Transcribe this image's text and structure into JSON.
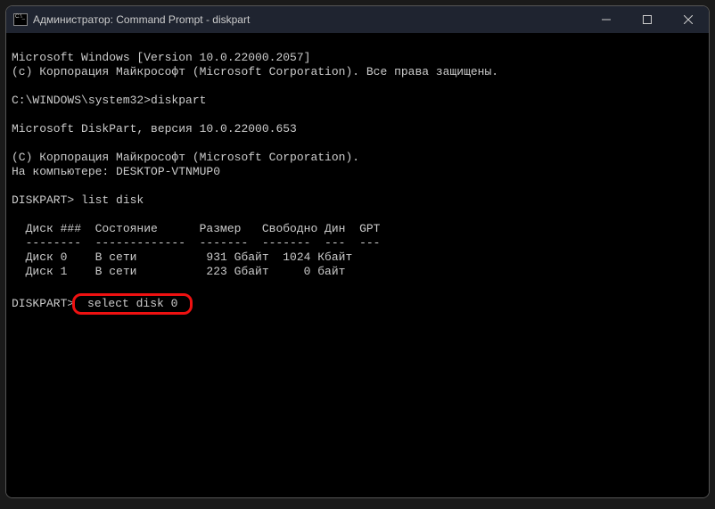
{
  "titlebar": {
    "title": "Администратор: Command Prompt - diskpart"
  },
  "terminal": {
    "line1": "Microsoft Windows [Version 10.0.22000.2057]",
    "line2": "(c) Корпорация Майкрософт (Microsoft Corporation). Все права защищены.",
    "prompt1_path": "C:\\WINDOWS\\system32>",
    "prompt1_cmd": "diskpart",
    "dp_version": "Microsoft DiskPart, версия 10.0.22000.653",
    "dp_copyright": "(C) Корпорация Майкрософт (Microsoft Corporation).",
    "dp_computer": "На компьютере: DESKTOP-VTNMUP0",
    "prompt2_label": "DISKPART> ",
    "prompt2_cmd": "list disk",
    "table_header": "  Диск ###  Состояние      Размер   Свободно Дин  GPT",
    "table_sep": "  --------  -------------  -------  -------  ---  ---",
    "row0": "  Диск 0    В сети          931 Gбайт  1024 Кбайт",
    "row1": "  Диск 1    В сети          223 Gбайт     0 байт",
    "prompt3_label": "DISKPART>",
    "prompt3_cmd": " select disk 0 "
  }
}
